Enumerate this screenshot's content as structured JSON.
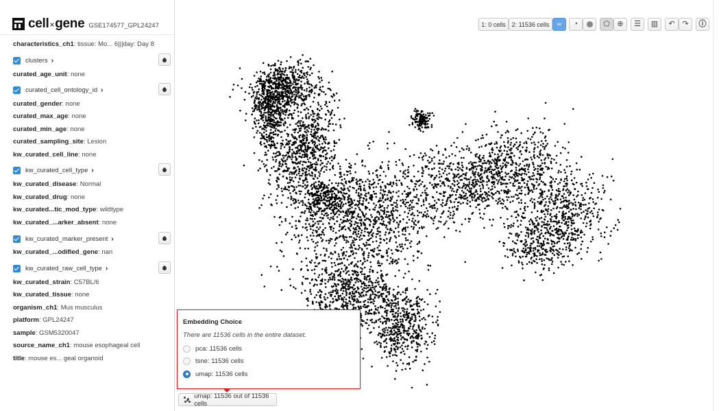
{
  "app": {
    "name_left": "cell",
    "name_x": "×",
    "name_right": "gene",
    "dataset": "GSE174577_GPL24247"
  },
  "sidebar": {
    "characteristics": {
      "key": "characteristics_ch1",
      "value": ": tissue: Mo... 6|||day: Day 8"
    },
    "clusters": {
      "label": "clusters",
      "chevron": "›"
    },
    "curated_age_unit": {
      "key": "curated_age_unit",
      "value": ": none"
    },
    "curated_cell_ontology_id": {
      "label": "curated_cell_ontology_id",
      "chevron": "›"
    },
    "curated_gender": {
      "key": "curated_gender",
      "value": ": none"
    },
    "curated_max_age": {
      "key": "curated_max_age",
      "value": ": none"
    },
    "curated_min_age": {
      "key": "curated_min_age",
      "value": ": none"
    },
    "curated_sampling_site": {
      "key": "curated_sampling_site",
      "value": ": Lesion"
    },
    "kw_curated_cell_line": {
      "key": "kw_curated_cell_line",
      "value": ": none"
    },
    "kw_curated_cell_type": {
      "label": "kw_curated_cell_type",
      "chevron": "›"
    },
    "kw_curated_disease": {
      "key": "kw_curated_disease",
      "value": ": Normal"
    },
    "kw_curated_drug": {
      "key": "kw_curated_drug",
      "value": ": none"
    },
    "kw_curated_genetic_mod_type": {
      "key": "kw_curated...tic_mod_type",
      "value": ": wildtype"
    },
    "kw_curated_marker_absent": {
      "key": "kw_curated_...arker_absent",
      "value": ": none"
    },
    "kw_curated_marker_present": {
      "label": "kw_curated_marker_present",
      "chevron": "›"
    },
    "kw_curated_modified_gene": {
      "key": "kw_curated_...odified_gene",
      "value": ": nan"
    },
    "kw_curated_raw_cell_type": {
      "label": "kw_curated_raw_cell_type",
      "chevron": "›"
    },
    "kw_curated_strain": {
      "key": "kw_curated_strain",
      "value": ": C57BL/6"
    },
    "kw_curated_tissue": {
      "key": "kw_curated_tissue",
      "value": ": none"
    },
    "organism_ch1": {
      "key": "organism_ch1",
      "value": ": Mus musculus"
    },
    "platform": {
      "key": "platform",
      "value": ": GPL24247"
    },
    "sample": {
      "key": "sample",
      "value": ": GSM5320047"
    },
    "source_name_ch1": {
      "key": "source_name_ch1",
      "value": ": mouse esophageal cell"
    },
    "title": {
      "key": "title",
      "value": ": mouse es... geal organoid"
    }
  },
  "toolbar": {
    "selection1": "1: 0 cells",
    "selection2": "2: 11536 cells"
  },
  "embedding": {
    "popup_title": "Embedding Choice",
    "popup_subtitle": "There are 11536 cells in the entire dataset.",
    "options": [
      {
        "label": "pca: 11536 cells",
        "selected": false
      },
      {
        "label": "tsne: 11536 cells",
        "selected": false
      },
      {
        "label": "umap: 11536 cells",
        "selected": true
      }
    ],
    "button_label": "umap: 11536 out of 11536 cells"
  },
  "colors": {
    "accent": "#2c8dd6",
    "popup_border": "#d32222",
    "points": "#000000"
  }
}
